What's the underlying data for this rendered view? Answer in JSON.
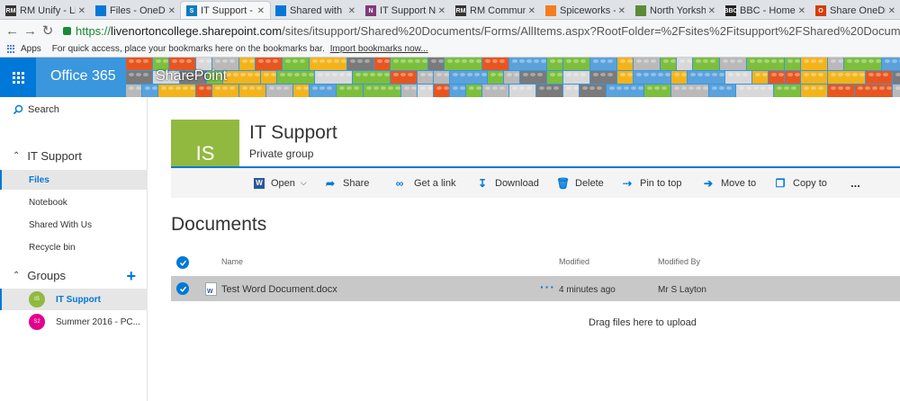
{
  "browser": {
    "tabs": [
      {
        "title": "RM Unify - Li",
        "fav": "RM",
        "color": "#333333"
      },
      {
        "title": "Files - OneDr",
        "fav": "cloud",
        "color": "#0078d7"
      },
      {
        "title": "IT Support - L",
        "fav": "S",
        "color": "#0f7bbf",
        "active": true
      },
      {
        "title": "Shared with",
        "fav": "cloud",
        "color": "#0078d7"
      },
      {
        "title": "IT Support N",
        "fav": "N",
        "color": "#80397b"
      },
      {
        "title": "RM Commun",
        "fav": "RM",
        "color": "#333333"
      },
      {
        "title": "Spiceworks -",
        "fav": "sw",
        "color": "#f47d20"
      },
      {
        "title": "North Yorksh",
        "fav": "ny",
        "color": "#5a8a3a"
      },
      {
        "title": "BBC - Home",
        "fav": "BBC",
        "color": "#222222"
      },
      {
        "title": "Share OneDr",
        "fav": "O",
        "color": "#d83b01"
      }
    ],
    "url_scheme": "https://",
    "url_host": "livenortoncollege.sharepoint.com",
    "url_path": "/sites/itsupport/Shared%20Documents/Forms/AllItems.aspx?RootFolder=%2Fsites%2Fitsupport%2FShared%20Docum",
    "bookmarks": {
      "apps": "Apps",
      "message": "For quick access, place your bookmarks here on the bookmarks bar.",
      "import_link": "Import bookmarks now..."
    }
  },
  "suite": {
    "brand": "Office 365",
    "app": "SharePoint",
    "accent": "#0078d7"
  },
  "nav": {
    "search": "Search",
    "site_header": "IT Support",
    "items": [
      {
        "label": "Files",
        "selected": true
      },
      {
        "label": "Notebook"
      },
      {
        "label": "Shared With Us"
      },
      {
        "label": "Recycle bin"
      }
    ],
    "groups_header": "Groups",
    "groups": [
      {
        "initials": "IS",
        "label": "IT Support",
        "color": "#92b93f",
        "selected": true
      },
      {
        "initials": "S2",
        "label": "Summer 2016 - PC...",
        "color": "#e3008c"
      }
    ]
  },
  "site": {
    "initials": "IS",
    "title": "IT Support",
    "subtitle": "Private group",
    "tile_color": "#92b93f"
  },
  "commands": [
    {
      "label": "Open",
      "icon": "word-icon",
      "dropdown": true
    },
    {
      "label": "Share",
      "icon": "share-icon"
    },
    {
      "label": "Get a link",
      "icon": "link-icon"
    },
    {
      "label": "Download",
      "icon": "download-icon"
    },
    {
      "label": "Delete",
      "icon": "delete-icon"
    },
    {
      "label": "Pin to top",
      "icon": "pin-icon"
    },
    {
      "label": "Move to",
      "icon": "move-icon"
    },
    {
      "label": "Copy to",
      "icon": "copy-icon"
    },
    {
      "label": "...",
      "icon": "more-icon"
    }
  ],
  "library": {
    "title": "Documents",
    "columns": {
      "name": "Name",
      "modified": "Modified",
      "modified_by": "Modified By"
    },
    "rows": [
      {
        "name": "Test Word Document.docx",
        "modified": "4 minutes ago",
        "modified_by": "Mr S Layton",
        "selected": true
      }
    ],
    "drag_hint": "Drag files here to upload"
  }
}
